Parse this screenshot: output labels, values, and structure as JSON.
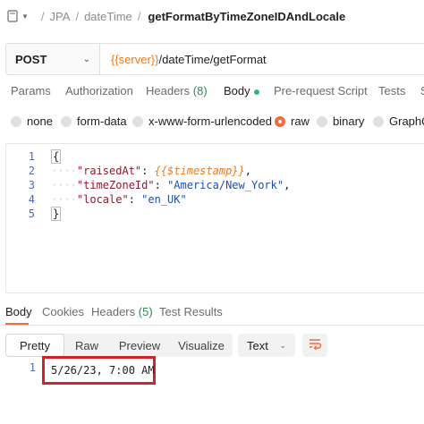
{
  "breadcrumb": {
    "items": [
      "JPA",
      "dateTime"
    ],
    "current": "getFormatByTimeZoneIDAndLocale",
    "separator": "/"
  },
  "request": {
    "method": "POST",
    "url_variable": "{{server}}",
    "url_path": "/dateTime/getFormat"
  },
  "request_tabs": {
    "params": "Params",
    "authorization": "Authorization",
    "headers": "Headers",
    "headers_count": "(8)",
    "body": "Body",
    "pre_request_script": "Pre-request Script",
    "tests": "Tests",
    "settings": "S"
  },
  "body_types": {
    "none": "none",
    "form_data": "form-data",
    "urlencoded": "x-www-form-urlencoded",
    "raw": "raw",
    "binary": "binary",
    "graphql": "GraphQL",
    "selected": "raw"
  },
  "editor": {
    "line_numbers": [
      "1",
      "2",
      "3",
      "4",
      "5"
    ],
    "open_brace": "{",
    "close_brace": "}",
    "guide": "····",
    "fields": [
      {
        "key": "\"raisedAt\"",
        "colon": ": ",
        "value": "{{$timestamp}}",
        "value_type": "variable",
        "trail": ","
      },
      {
        "key": "\"timeZoneId\"",
        "colon": ": ",
        "value": "\"America/New_York\"",
        "value_type": "string",
        "trail": ","
      },
      {
        "key": "\"locale\"",
        "colon": ": ",
        "value": "\"en_UK\"",
        "value_type": "string",
        "trail": ""
      }
    ]
  },
  "response_tabs": {
    "body": "Body",
    "cookies": "Cookies",
    "headers": "Headers",
    "headers_count": "(5)",
    "test_results": "Test Results"
  },
  "response_view": {
    "pretty": "Pretty",
    "raw": "Raw",
    "preview": "Preview",
    "visualize": "Visualize",
    "format": "Text",
    "wrap_icon": "wrap-lines-icon"
  },
  "response": {
    "line_number": "1",
    "value": "5/26/23, 7:00 AM"
  },
  "colors": {
    "accent": "#f26b3a",
    "variable": "#e77c1f",
    "highlight_border": "#d3222a",
    "json_key": "#8b1a2e",
    "json_string": "#1f4ea8"
  }
}
